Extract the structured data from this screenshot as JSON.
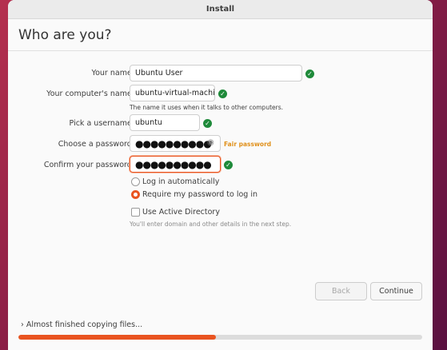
{
  "window": {
    "title": "Install"
  },
  "page": {
    "heading": "Who are you?"
  },
  "form": {
    "name": {
      "label": "Your name:",
      "value": "Ubuntu User"
    },
    "computer": {
      "label": "Your computer's name:",
      "value": "ubuntu-virtual-machine",
      "hint": "The name it uses when it talks to other computers."
    },
    "username": {
      "label": "Pick a username:",
      "value": "ubuntu"
    },
    "password": {
      "label": "Choose a password:",
      "value": "●●●●●●●●●●",
      "strength": "Fair password"
    },
    "confirm": {
      "label": "Confirm your password:",
      "value": "●●●●●●●●●●"
    },
    "login_auto": {
      "label": "Log in automatically",
      "selected": false
    },
    "login_password": {
      "label": "Require my password to log in",
      "selected": true
    },
    "active_directory": {
      "label": "Use Active Directory",
      "checked": false,
      "hint": "You'll enter domain and other details in the next step."
    }
  },
  "buttons": {
    "back": "Back",
    "continue": "Continue"
  },
  "status": {
    "text": "Almost finished copying files...",
    "progress_fraction": 0.49
  },
  "colors": {
    "accent": "#e95420",
    "ok": "#1e8a3a",
    "warning": "#e0901a"
  },
  "icons": {
    "ok": "check-circle-icon",
    "eye": "eye-icon",
    "expander": "chevron-right-icon"
  }
}
